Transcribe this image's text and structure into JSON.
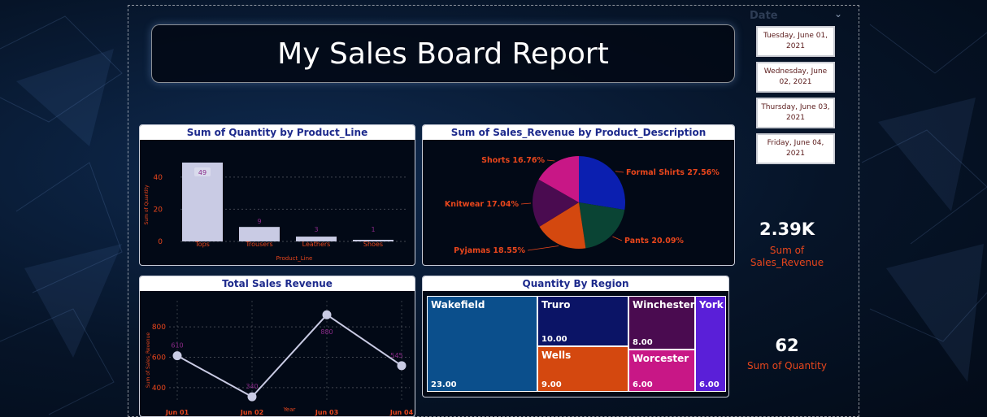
{
  "report": {
    "title": "My Sales Board Report"
  },
  "date_slicer": {
    "header": "Date",
    "options": [
      "Tuesday, June 01, 2021",
      "Wednesday, June 02, 2021",
      "Thursday, June 03, 2021",
      "Friday, June 04, 2021"
    ]
  },
  "kpis": {
    "sales_revenue": {
      "value": "2.39K",
      "label": "Sum of Sales_Revenue"
    },
    "quantity": {
      "value": "62",
      "label": "Sum of Quantity"
    }
  },
  "colors": {
    "bar": "#c9cbe4",
    "data_label": "#8a2a8a",
    "axis_label": "#e8461c",
    "panel_title": "#1d2a8c",
    "line": "#c9cbe4"
  },
  "chart_data": [
    {
      "type": "bar",
      "title": "Sum of Quantity by Product_Line",
      "xlabel": "Product_Line",
      "ylabel": "Sum of Quantity",
      "categories": [
        "Tops",
        "Trousers",
        "Leathers",
        "Shoes"
      ],
      "values": [
        49,
        9,
        3,
        1
      ],
      "value_labels": [
        "49",
        "9",
        "3",
        "1"
      ],
      "yticks": [
        "0",
        "20",
        "40"
      ],
      "ylim": [
        0,
        50
      ],
      "grid": true
    },
    {
      "type": "pie",
      "title": "Sum of Sales_Revenue by Product_Description",
      "slices": [
        {
          "name": "Formal Shirts",
          "value": 27.56,
          "label": "Formal Shirts 27.56%",
          "color": "#0b1fb0"
        },
        {
          "name": "Pants",
          "value": 20.09,
          "label": "Pants 20.09%",
          "color": "#0a4434"
        },
        {
          "name": "Pyjamas",
          "value": 18.55,
          "label": "Pyjamas 18.55%",
          "color": "#d4480f"
        },
        {
          "name": "Knitwear",
          "value": 17.04,
          "label": "Knitwear 17.04%",
          "color": "#4a0b50"
        },
        {
          "name": "Shorts",
          "value": 16.76,
          "label": "Shorts 16.76%",
          "color": "#c81786"
        }
      ]
    },
    {
      "type": "line",
      "title": "Total Sales Revenue",
      "xlabel": "Year",
      "ylabel": "Sum of Sales_Revenue",
      "x": [
        "Jun 01",
        "Jun 02",
        "Jun 03",
        "Jun 04"
      ],
      "values": [
        610,
        340,
        880,
        545
      ],
      "value_labels": [
        "610",
        "340",
        "880",
        "545"
      ],
      "yticks": [
        "400",
        "600",
        "800"
      ],
      "ylim": [
        330,
        940
      ],
      "grid": true
    },
    {
      "type": "treemap",
      "title": "Quantity By Region",
      "items": [
        {
          "name": "Wakefield",
          "value": 23.0,
          "label": "23.00",
          "color": "#0b4f8c"
        },
        {
          "name": "Truro",
          "value": 10.0,
          "label": "10.00",
          "color": "#0b1466"
        },
        {
          "name": "Wells",
          "value": 9.0,
          "label": "9.00",
          "color": "#d4480f"
        },
        {
          "name": "Winchester",
          "value": 8.0,
          "label": "8.00",
          "color": "#4a0b50"
        },
        {
          "name": "Worcester",
          "value": 6.0,
          "label": "6.00",
          "color": "#c81786"
        },
        {
          "name": "York",
          "value": 6.0,
          "label": "6.00",
          "color": "#5a1fd8"
        }
      ]
    }
  ]
}
